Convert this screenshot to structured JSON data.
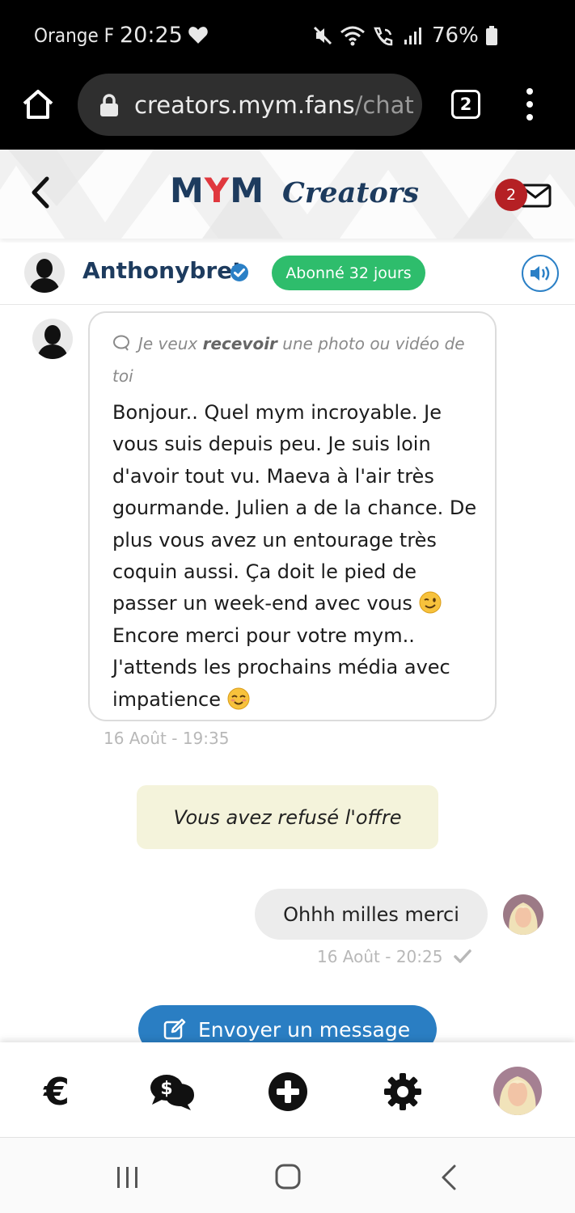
{
  "status_bar": {
    "carrier": "Orange F",
    "time": "20:25",
    "battery": "76%",
    "icons": [
      "heart-icon",
      "mute-icon",
      "wifi-icon",
      "wifi-calling-icon",
      "signal-icon",
      "battery-icon"
    ]
  },
  "browser": {
    "url_host": "creators.mym.fans",
    "url_path": "/chat",
    "tab_count": "2"
  },
  "header": {
    "logo_mym": "MYM",
    "logo_creators": "Creators",
    "mail_badge": "2"
  },
  "contact": {
    "name": "Anthonybret",
    "subscription_badge": "Abonné 32 jours",
    "colors": {
      "name": "#1d3b5e",
      "badge": "#2ebd6c"
    }
  },
  "chat": {
    "incoming": {
      "request_prefix": "Je veux ",
      "request_emphasis": "recevoir",
      "request_suffix": " une photo ou vidéo de toi",
      "text_part1": "Bonjour.. Quel mym incroyable. Je vous suis depuis peu. Je suis loin d'avoir tout vu. Maeva à l'air très gourmande. Julien a de la chance. De plus vous avez un entourage très coquin aussi. Ça doit le pied de passer un week-end avec vous ",
      "emoji1": "wink-emoji",
      "text_part2": " Encore merci pour votre mym.. J'attends les prochains média avec impatience ",
      "emoji2": "smiling-blush-emoji",
      "timestamp": "16 Août - 19:35"
    },
    "offer_status": "Vous avez refusé l'offre",
    "outgoing": {
      "text": "Ohhh milles merci",
      "timestamp": "16 Août - 20:25",
      "status_icon": "check-icon"
    },
    "send_button": "Envoyer un message"
  },
  "bottom_nav": {
    "euro_symbol": "€",
    "items": [
      "euro-icon",
      "money-chat-icon",
      "add-circle-icon",
      "settings-gear-icon",
      "profile-avatar"
    ]
  },
  "system_nav": [
    "recent-apps-icon",
    "home-icon",
    "back-icon"
  ],
  "colors": {
    "accent_blue": "#2a7ec3",
    "badge_red": "#b52024",
    "offer_bg": "#f4f3db",
    "logo_red": "#e0383e"
  }
}
